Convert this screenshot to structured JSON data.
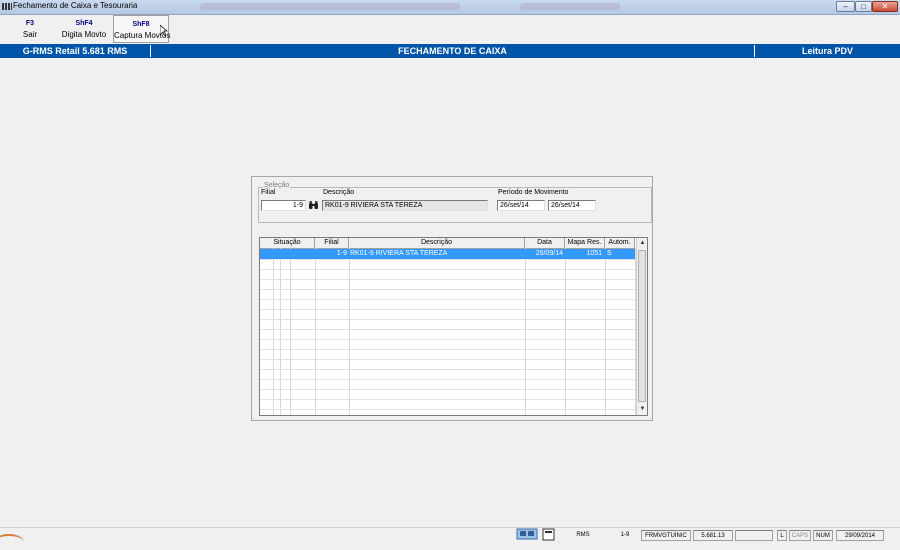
{
  "window": {
    "title": "Fechamento de Caixa e Tesouraria",
    "controls": {
      "minimize": "–",
      "maximize": "□",
      "close": "✕"
    }
  },
  "toolbar": {
    "items": [
      {
        "key": "F3",
        "label": "Sair"
      },
      {
        "key": "ShF4",
        "label": "Digita Movto"
      },
      {
        "key": "ShF8",
        "label": "Captura Movtos"
      }
    ]
  },
  "header": {
    "left": "G-RMS Retail 5.681 RMS",
    "center": "FECHAMENTO DE CAIXA",
    "right": "Leitura PDV"
  },
  "selecao": {
    "legend": "Seleção",
    "filial_label": "Filial",
    "filial_value": "1-9",
    "descricao_label": "Descrição",
    "descricao_value": "RK01-9 RIVIERA STA TEREZA",
    "periodo_label": "Período de Movimento",
    "periodo_inicio": "26/set/14",
    "periodo_fim": "26/set/14"
  },
  "grid": {
    "columns": [
      "Situação",
      "Filial",
      "Descrição",
      "Data",
      "Mapa Res.",
      "Autom."
    ],
    "rows": [
      {
        "situacao": "",
        "filial": "1-9",
        "descricao": "RK01-9 RIVIERA STA TEREZA",
        "data": "26/09/14",
        "mapa": "1051",
        "autom": "S"
      }
    ]
  },
  "statusbar": {
    "system": "RMS",
    "filial": "1-9",
    "form": "FRMVGTUINIC",
    "version": "5.681.13",
    "l_flag": "L",
    "caps": "CAPS",
    "num": "NUM",
    "date": "29/09/2014"
  },
  "colors": {
    "header_blue": "#0055a8",
    "selected_row": "#3399ff",
    "toolbar_key": "#000080"
  }
}
